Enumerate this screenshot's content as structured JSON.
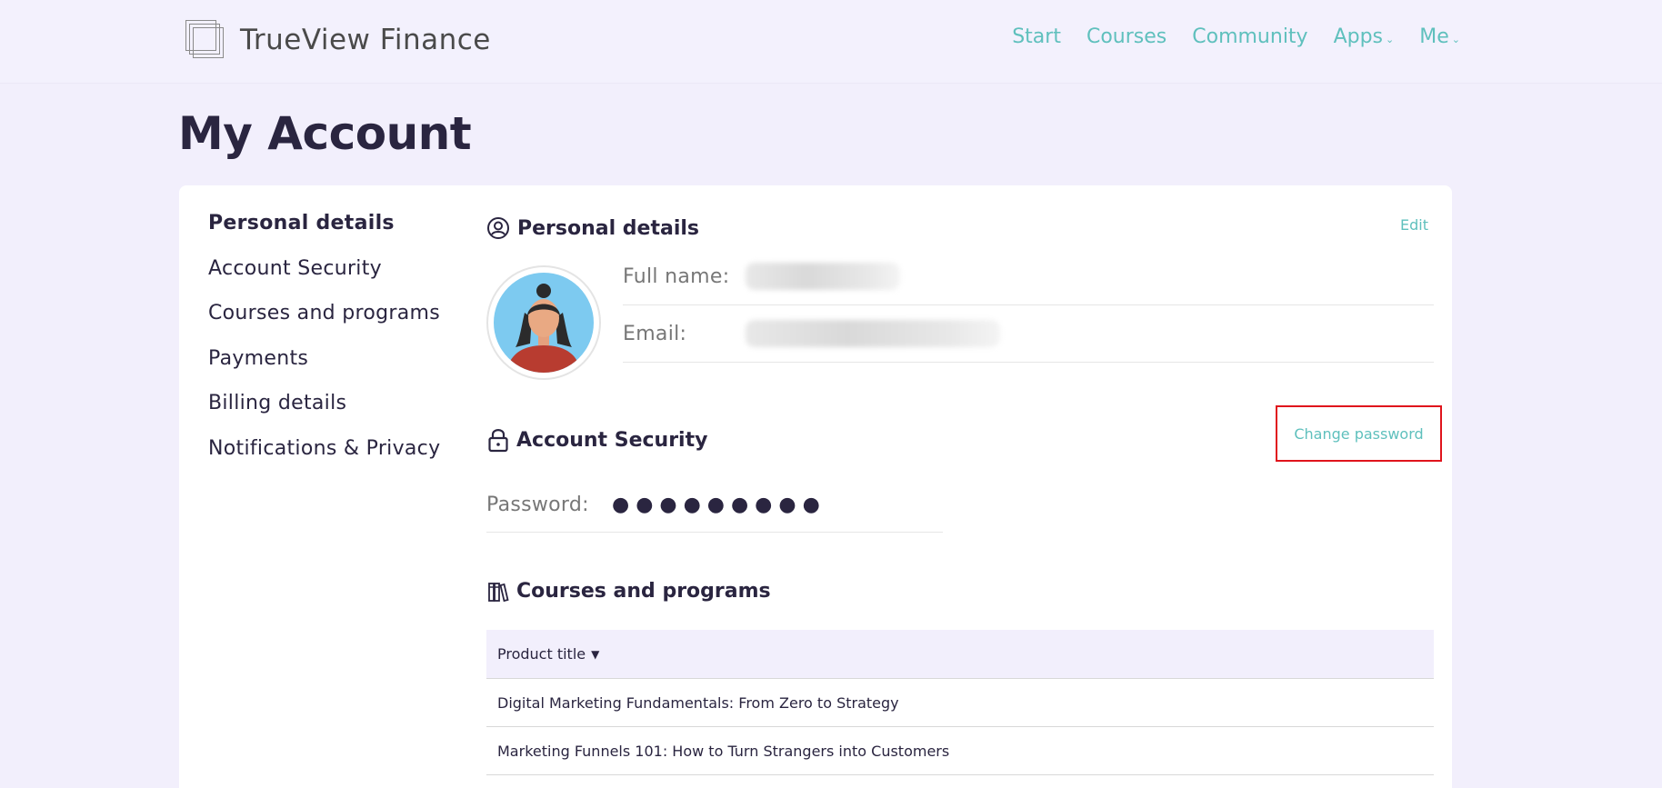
{
  "header": {
    "brand": "TrueView Finance",
    "nav": [
      {
        "label": "Start"
      },
      {
        "label": "Courses"
      },
      {
        "label": "Community"
      },
      {
        "label": "Apps",
        "dropdown": true
      },
      {
        "label": "Me",
        "dropdown": true
      }
    ]
  },
  "page_title": "My Account",
  "sidebar": {
    "items": [
      {
        "label": "Personal details",
        "active": true
      },
      {
        "label": "Account Security"
      },
      {
        "label": "Courses and programs"
      },
      {
        "label": "Payments"
      },
      {
        "label": "Billing details"
      },
      {
        "label": "Notifications & Privacy"
      }
    ]
  },
  "personal": {
    "title": "Personal details",
    "edit_label": "Edit",
    "full_name_label": "Full name:",
    "email_label": "Email:"
  },
  "security": {
    "title": "Account Security",
    "change_password_label": "Change password",
    "password_label": "Password:",
    "password_mask": "●●●●●●●●●"
  },
  "courses": {
    "title": "Courses and programs",
    "column_header": "Product title",
    "rows": [
      "Digital Marketing Fundamentals: From Zero to Strategy",
      "Marketing Funnels 101: How to Turn Strangers into Customers"
    ]
  },
  "colors": {
    "accent": "#5fc0bd",
    "background": "#f2effc",
    "text": "#2a2540",
    "highlight_box": "#e0141c"
  }
}
